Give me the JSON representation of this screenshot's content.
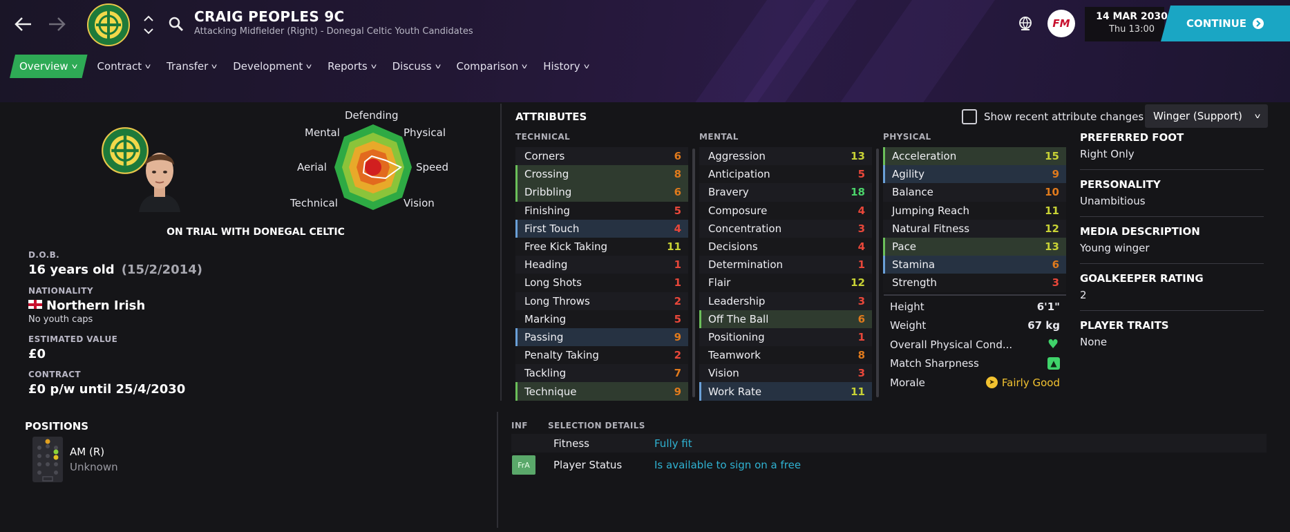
{
  "header": {
    "player_name": "CRAIG PEOPLES 9C",
    "player_subtitle": "Attacking Midfielder (Right) - Donegal Celtic Youth Candidates",
    "fm_logo_text": "FM",
    "date_main": "14 MAR 2030",
    "date_sub": "Thu 13:00",
    "continue_label": "CONTINUE",
    "icons": [
      "back-arrow-icon",
      "forward-arrow-icon",
      "club-badge",
      "chevron-up-icon",
      "chevron-down-icon",
      "search-icon",
      "globe-icon"
    ]
  },
  "nav": {
    "items": [
      "Overview",
      "Contract",
      "Transfer",
      "Development",
      "Reports",
      "Discuss",
      "Comparison",
      "History"
    ],
    "active": "Overview"
  },
  "profile": {
    "radar_labels": {
      "top": "Defending",
      "top_left": "Mental",
      "top_right": "Physical",
      "left": "Aerial",
      "right": "Speed",
      "bottom_left": "Technical",
      "bottom_right": "Vision"
    },
    "trial_text": "ON TRIAL WITH DONEGAL CELTIC",
    "dob_label": "D.O.B.",
    "dob_value": "16 years old",
    "dob_extra": "(15/2/2014)",
    "nationality_label": "NATIONALITY",
    "nationality_value": "Northern Irish",
    "youth_caps": "No youth caps",
    "value_label": "ESTIMATED VALUE",
    "value_value": "£0",
    "contract_label": "CONTRACT",
    "contract_value": "£0 p/w until 25/4/2030",
    "positions_title": "POSITIONS",
    "position_name": "AM (R)",
    "position_rating": "Unknown"
  },
  "attributes": {
    "title": "ATTRIBUTES",
    "recent_changes_label": "Show recent attribute changes",
    "role_select": "Winger (Support)",
    "technical_header": "TECHNICAL",
    "mental_header": "MENTAL",
    "physical_header": "PHYSICAL",
    "colors": {
      "low": "#e8473a",
      "mid": "#e07a1c",
      "good": "#c8d235",
      "high": "#4bd36a"
    },
    "technical": [
      {
        "name": "Corners",
        "value": "6",
        "hl": ""
      },
      {
        "name": "Crossing",
        "value": "8",
        "hl": "green"
      },
      {
        "name": "Dribbling",
        "value": "6",
        "hl": "green"
      },
      {
        "name": "Finishing",
        "value": "5",
        "hl": ""
      },
      {
        "name": "First Touch",
        "value": "4",
        "hl": "blue"
      },
      {
        "name": "Free Kick Taking",
        "value": "11",
        "hl": ""
      },
      {
        "name": "Heading",
        "value": "1",
        "hl": ""
      },
      {
        "name": "Long Shots",
        "value": "1",
        "hl": ""
      },
      {
        "name": "Long Throws",
        "value": "2",
        "hl": ""
      },
      {
        "name": "Marking",
        "value": "5",
        "hl": ""
      },
      {
        "name": "Passing",
        "value": "9",
        "hl": "blue"
      },
      {
        "name": "Penalty Taking",
        "value": "2",
        "hl": ""
      },
      {
        "name": "Tackling",
        "value": "7",
        "hl": ""
      },
      {
        "name": "Technique",
        "value": "9",
        "hl": "green"
      }
    ],
    "mental": [
      {
        "name": "Aggression",
        "value": "13",
        "hl": ""
      },
      {
        "name": "Anticipation",
        "value": "5",
        "hl": ""
      },
      {
        "name": "Bravery",
        "value": "18",
        "hl": ""
      },
      {
        "name": "Composure",
        "value": "4",
        "hl": ""
      },
      {
        "name": "Concentration",
        "value": "3",
        "hl": ""
      },
      {
        "name": "Decisions",
        "value": "4",
        "hl": ""
      },
      {
        "name": "Determination",
        "value": "1",
        "hl": ""
      },
      {
        "name": "Flair",
        "value": "12",
        "hl": ""
      },
      {
        "name": "Leadership",
        "value": "3",
        "hl": ""
      },
      {
        "name": "Off The Ball",
        "value": "6",
        "hl": "green"
      },
      {
        "name": "Positioning",
        "value": "1",
        "hl": ""
      },
      {
        "name": "Teamwork",
        "value": "8",
        "hl": ""
      },
      {
        "name": "Vision",
        "value": "3",
        "hl": ""
      },
      {
        "name": "Work Rate",
        "value": "11",
        "hl": "blue"
      }
    ],
    "physical": [
      {
        "name": "Acceleration",
        "value": "15",
        "hl": "green"
      },
      {
        "name": "Agility",
        "value": "9",
        "hl": "blue"
      },
      {
        "name": "Balance",
        "value": "10",
        "hl": ""
      },
      {
        "name": "Jumping Reach",
        "value": "11",
        "hl": ""
      },
      {
        "name": "Natural Fitness",
        "value": "12",
        "hl": ""
      },
      {
        "name": "Pace",
        "value": "13",
        "hl": "green"
      },
      {
        "name": "Stamina",
        "value": "6",
        "hl": "blue"
      },
      {
        "name": "Strength",
        "value": "3",
        "hl": ""
      }
    ],
    "height_label": "Height",
    "height_value": "6'1\"",
    "weight_label": "Weight",
    "weight_value": "67 kg",
    "condition_label": "Overall Physical Cond...",
    "sharpness_label": "Match Sharpness",
    "morale_label": "Morale",
    "morale_value": "Fairly Good"
  },
  "info": {
    "preferred_foot_label": "PREFERRED FOOT",
    "preferred_foot_value": "Right Only",
    "personality_label": "PERSONALITY",
    "personality_value": "Unambitious",
    "media_label": "MEDIA DESCRIPTION",
    "media_value": "Young winger",
    "gk_label": "GOALKEEPER RATING",
    "gk_value": "2",
    "traits_label": "PLAYER TRAITS",
    "traits_value": "None"
  },
  "selection": {
    "inf_header": "INF",
    "details_header": "SELECTION DETAILS",
    "fitness_label": "Fitness",
    "fitness_value": "Fully fit",
    "status_badge": "FrA",
    "status_label": "Player Status",
    "status_value": "Is available to sign on a free"
  }
}
